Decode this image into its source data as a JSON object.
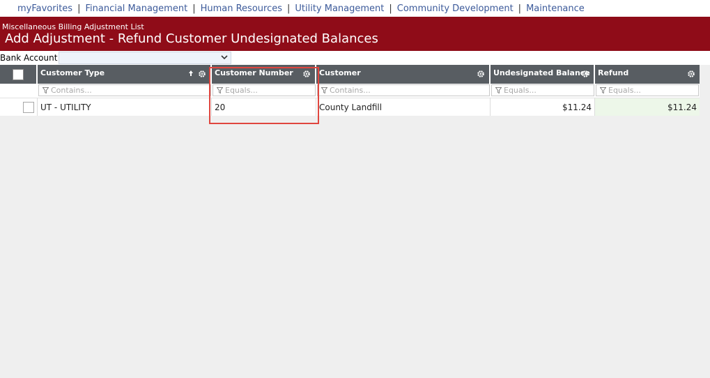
{
  "nav": {
    "items": [
      "myFavorites",
      "Financial Management",
      "Human Resources",
      "Utility Management",
      "Community Development",
      "Maintenance"
    ],
    "separator": "|"
  },
  "header": {
    "breadcrumb": "Miscellaneous Billing Adjustment List",
    "title": "Add Adjustment - Refund Customer Undesignated Balances"
  },
  "bank_account": {
    "label": "Bank Account",
    "value": ""
  },
  "grid": {
    "columns": [
      {
        "label": "Customer Type",
        "filter_placeholder": "Contains...",
        "sorted": "asc"
      },
      {
        "label": "Customer Number",
        "filter_placeholder": "Equals..."
      },
      {
        "label": "Customer",
        "filter_placeholder": "Contains..."
      },
      {
        "label": "Undesignated Balance",
        "filter_placeholder": "Equals..."
      },
      {
        "label": "Refund",
        "filter_placeholder": "Equals..."
      }
    ],
    "rows": [
      {
        "customer_type": "UT - UTILITY",
        "customer_number": "20",
        "customer": "County Landfill",
        "undesignated_balance": "$11.24",
        "refund": "$11.24"
      }
    ]
  },
  "icons": {
    "gear": "gear-icon",
    "sort": "sort-up-arrow-icon",
    "filter": "funnel-icon",
    "dropdown": "chevron-down-icon"
  },
  "colors": {
    "header_bg": "#8f0c18",
    "grid_header_bg": "#585d62",
    "refund_cell_bg": "#edf7e9",
    "highlight": "#e0463f",
    "nav_link": "#3c5a9a"
  }
}
